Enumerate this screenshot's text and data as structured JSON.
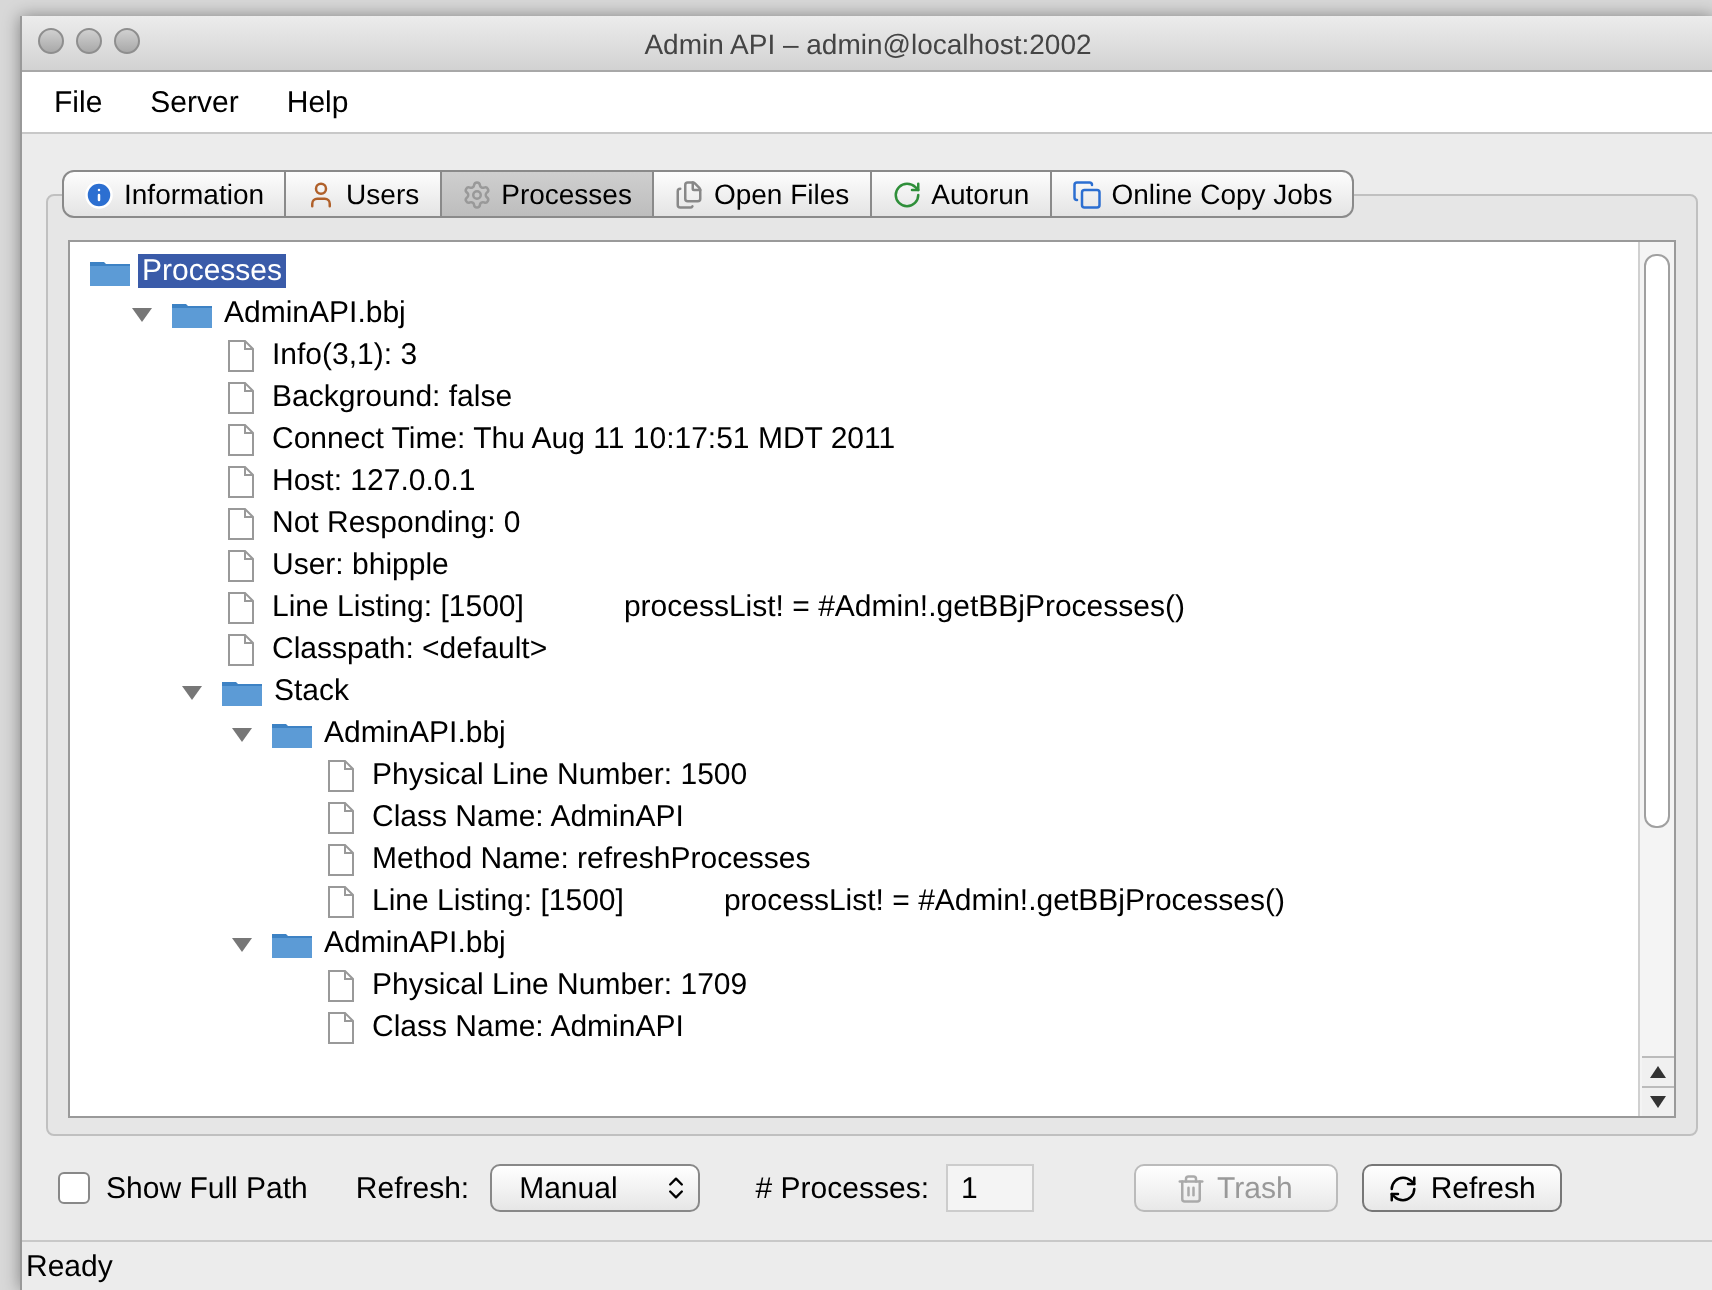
{
  "window": {
    "title": "Admin API – admin@localhost:2002"
  },
  "menu": [
    "File",
    "Server",
    "Help"
  ],
  "tabs": [
    {
      "label": "Information",
      "kind": "info",
      "selected": false
    },
    {
      "label": "Users",
      "kind": "users",
      "selected": false
    },
    {
      "label": "Processes",
      "kind": "processes",
      "selected": true
    },
    {
      "label": "Open Files",
      "kind": "files",
      "selected": false
    },
    {
      "label": "Autorun",
      "kind": "autorun",
      "selected": false
    },
    {
      "label": "Online Copy Jobs",
      "kind": "copy",
      "selected": false
    }
  ],
  "tree": {
    "label": "Processes",
    "kind": "folder",
    "selected": true,
    "children": [
      {
        "label": "AdminAPI.bbj",
        "kind": "folder",
        "expanded": true,
        "selected": false,
        "children": [
          {
            "label": "Info(3,1): 3",
            "kind": "file",
            "selected": false
          },
          {
            "label": "Background: false",
            "kind": "file",
            "selected": false
          },
          {
            "label": "Connect Time: Thu Aug 11 10:17:51 MDT 2011",
            "kind": "file",
            "selected": false
          },
          {
            "label": "Host: 127.0.0.1",
            "kind": "file",
            "selected": false
          },
          {
            "label": "Not Responding: 0",
            "kind": "file",
            "selected": false
          },
          {
            "label": "User: bhipple",
            "kind": "file",
            "selected": false
          },
          {
            "label": "Line Listing: [1500]",
            "code": "processList! = #Admin!.getBBjProcesses()",
            "kind": "file",
            "selected": false
          },
          {
            "label": "Classpath: <default>",
            "kind": "file",
            "selected": false
          },
          {
            "label": "Stack",
            "kind": "folder",
            "expanded": true,
            "selected": false,
            "children": [
              {
                "label": "AdminAPI.bbj",
                "kind": "folder",
                "expanded": true,
                "selected": false,
                "children": [
                  {
                    "label": "Physical Line Number: 1500",
                    "kind": "file",
                    "selected": false
                  },
                  {
                    "label": "Class Name: AdminAPI",
                    "kind": "file",
                    "selected": false
                  },
                  {
                    "label": "Method Name: refreshProcesses",
                    "kind": "file",
                    "selected": false
                  },
                  {
                    "label": "Line Listing: [1500]",
                    "code": "processList! = #Admin!.getBBjProcesses()",
                    "kind": "file",
                    "selected": false
                  }
                ]
              },
              {
                "label": "AdminAPI.bbj",
                "kind": "folder",
                "expanded": true,
                "selected": false,
                "children": [
                  {
                    "label": "Physical Line Number: 1709",
                    "kind": "file",
                    "selected": false
                  },
                  {
                    "label": "Class Name: AdminAPI",
                    "kind": "file",
                    "selected": false
                  }
                ]
              }
            ]
          }
        ]
      }
    ]
  },
  "footer": {
    "show_full_path": {
      "label": "Show Full Path",
      "checked": false
    },
    "refresh_label": "Refresh:",
    "refresh_mode": "Manual",
    "processes_label": "# Processes:",
    "processes_count": "1",
    "trash": {
      "label": "Trash",
      "disabled": true
    },
    "refresh": {
      "label": "Refresh",
      "disabled": false
    }
  },
  "status_bar": "Ready"
}
